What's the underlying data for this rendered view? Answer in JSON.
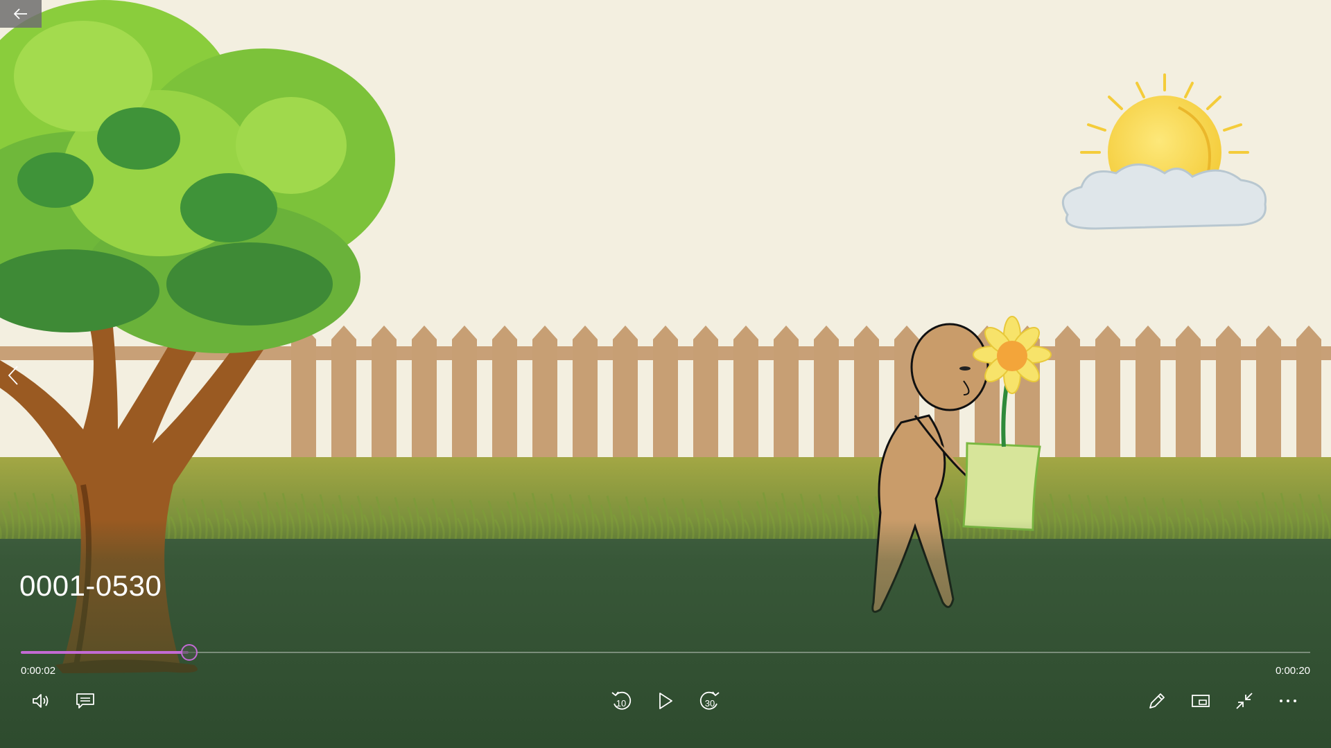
{
  "video": {
    "title": "0001-0530",
    "position": "0:00:02",
    "duration": "0:00:20",
    "progress": 0.13
  },
  "controls": {
    "rewind_seconds": "10",
    "forward_seconds": "30"
  },
  "colors": {
    "accent": "#c36ad4",
    "sky": "#f3efe0",
    "grass_dark": "#3d5b3d"
  }
}
